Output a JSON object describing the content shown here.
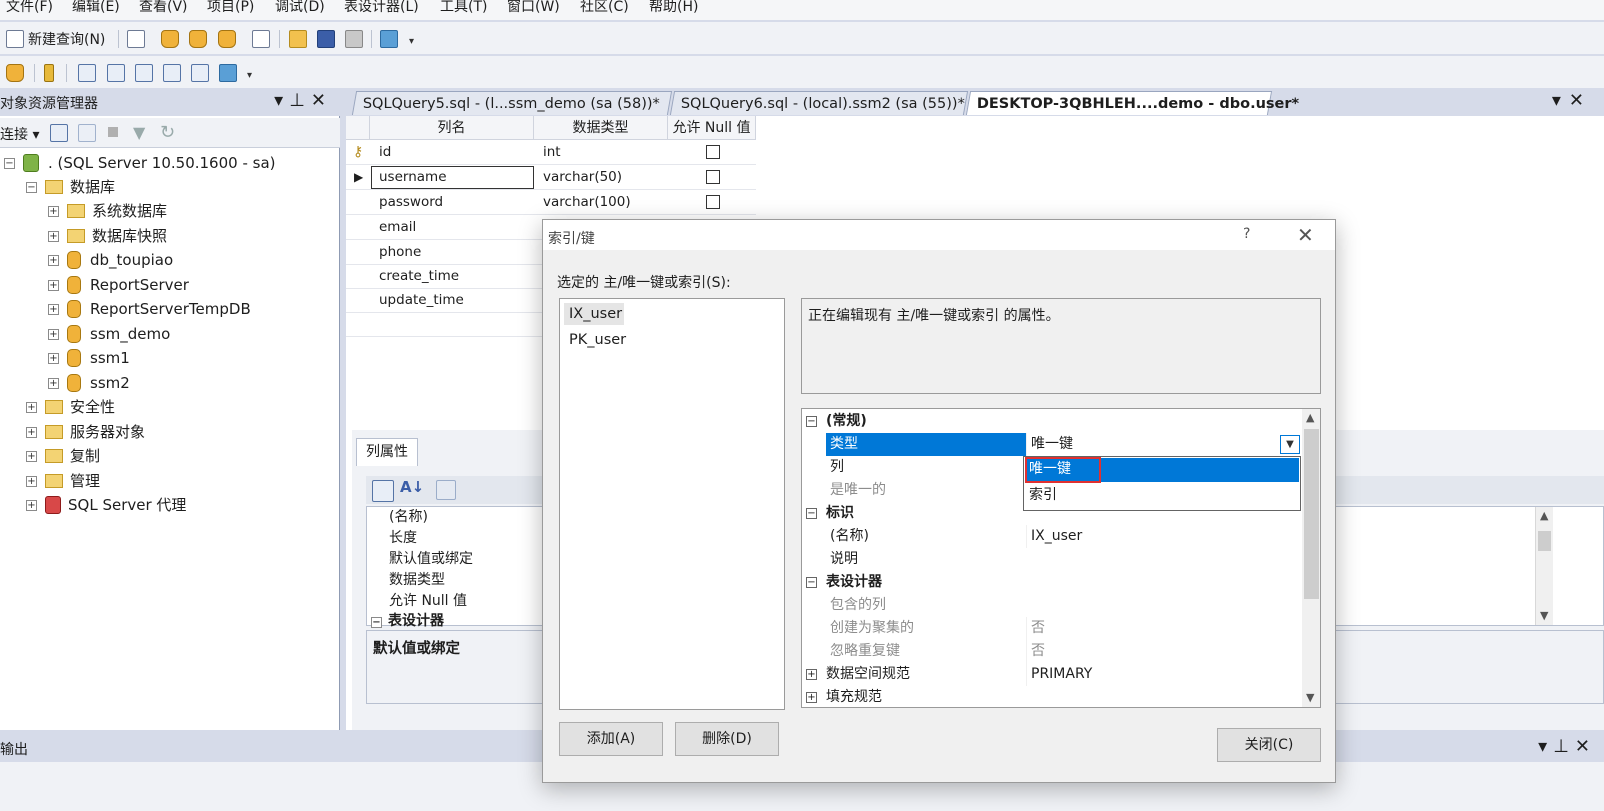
{
  "menu": [
    "文件(F)",
    "编辑(E)",
    "查看(V)",
    "项目(P)",
    "调试(D)",
    "表设计器(L)",
    "工具(T)",
    "窗口(W)",
    "社区(C)",
    "帮助(H)"
  ],
  "toolbar": {
    "new_query": "新建查询(N)"
  },
  "explorer": {
    "title": "对象资源管理器",
    "connect": "连接",
    "server": ". (SQL Server 10.50.1600 - sa)",
    "databases": "数据库",
    "db_items": [
      "系统数据库",
      "数据库快照",
      "db_toupiao",
      "ReportServer",
      "ReportServerTempDB",
      "ssm_demo",
      "ssm1",
      "ssm2"
    ],
    "top_items": [
      "安全性",
      "服务器对象",
      "复制",
      "管理",
      "SQL Server 代理"
    ]
  },
  "tabs": [
    "SQLQuery5.sql - (l...ssm_demo (sa (58))*",
    "SQLQuery6.sql - (local).ssm2 (sa (55))*",
    "DESKTOP-3QBHLEH....demo - dbo.user*"
  ],
  "designer": {
    "headers": [
      "列名",
      "数据类型",
      "允许 Null 值"
    ],
    "rows": [
      {
        "name": "id",
        "type": "int"
      },
      {
        "name": "username",
        "type": "varchar(50)"
      },
      {
        "name": "password",
        "type": "varchar(100)"
      },
      {
        "name": "email",
        "type": ""
      },
      {
        "name": "phone",
        "type": ""
      },
      {
        "name": "create_time",
        "type": ""
      },
      {
        "name": "update_time",
        "type": ""
      }
    ]
  },
  "column_properties": {
    "tab": "列属性",
    "rows": [
      "(名称)",
      "长度",
      "默认值或绑定",
      "数据类型",
      "允许 Null 值"
    ],
    "category": "表设计器",
    "desc_title": "默认值或绑定"
  },
  "output": {
    "title": "输出"
  },
  "dialog": {
    "title": "索引/键",
    "help": "?",
    "select_label": "选定的 主/唯一键或索引(S):",
    "list": [
      "IX_user",
      "PK_user"
    ],
    "description": "正在编辑现有 主/唯一键或索引 的属性。",
    "props": {
      "general": "(常规)",
      "type_key": "类型",
      "type_value": "唯一键",
      "columns_key": "列",
      "unique_key": "是唯一的",
      "identity": "标识",
      "name_key": "(名称)",
      "name_value": "IX_user",
      "desc_key": "说明",
      "table_designer": "表设计器",
      "included_key": "包含的列",
      "clustered_key": "创建为聚集的",
      "clustered_value": "否",
      "ignore_dup_key": "忽略重复键",
      "ignore_dup_value": "否",
      "data_space_key": "数据空间规范",
      "data_space_value": "PRIMARY",
      "fill_key": "填充规范"
    },
    "dropdown": [
      "唯一键",
      "索引"
    ],
    "add": "添加(A)",
    "delete": "删除(D)",
    "close": "关闭(C)"
  }
}
